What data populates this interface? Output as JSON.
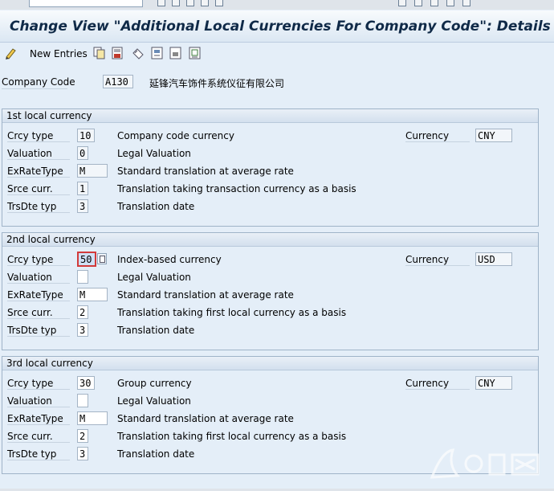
{
  "window": {
    "title": "Change View \"Additional Local Currencies For Company Code\": Details"
  },
  "toolbar": {
    "new_entries_label": "New Entries",
    "icons": [
      "glasses-edit-icon",
      "copy-icon",
      "save-icon",
      "undo-icon",
      "select-all-icon",
      "deselect-icon",
      "print-icon"
    ]
  },
  "company": {
    "label": "Company Code",
    "code": "A130",
    "name": "延锋汽车饰件系统仪征有限公司"
  },
  "groups": [
    {
      "title": "1st local currency",
      "crcy_type_label": "Crcy type",
      "crcy_type": "10",
      "crcy_type_desc": "Company code currency",
      "currency_label": "Currency",
      "currency": "CNY",
      "valuation_label": "Valuation",
      "valuation": "0",
      "valuation_desc": "Legal Valuation",
      "exratetype_label": "ExRateType",
      "exratetype": "M",
      "exratetype_desc": "Standard translation at average rate",
      "srce_label": "Srce curr.",
      "srce": "1",
      "srce_desc": "Translation taking transaction currency as a basis",
      "trsdte_label": "TrsDte typ",
      "trsdte": "3",
      "trsdte_desc": "Translation date"
    },
    {
      "title": "2nd local currency",
      "crcy_type_label": "Crcy type",
      "crcy_type": "50",
      "crcy_type_desc": "Index-based currency",
      "currency_label": "Currency",
      "currency": "USD",
      "valuation_label": "Valuation",
      "valuation": "",
      "valuation_desc": "Legal Valuation",
      "exratetype_label": "ExRateType",
      "exratetype": "M",
      "exratetype_desc": "Standard translation at average rate",
      "srce_label": "Srce curr.",
      "srce": "2",
      "srce_desc": "Translation taking first local currency as a basis",
      "trsdte_label": "TrsDte typ",
      "trsdte": "3",
      "trsdte_desc": "Translation date"
    },
    {
      "title": "3rd local currency",
      "crcy_type_label": "Crcy type",
      "crcy_type": "30",
      "crcy_type_desc": "Group currency",
      "currency_label": "Currency",
      "currency": "CNY",
      "valuation_label": "Valuation",
      "valuation": "",
      "valuation_desc": "Legal Valuation",
      "exratetype_label": "ExRateType",
      "exratetype": "M",
      "exratetype_desc": "Standard translation at average rate",
      "srce_label": "Srce curr.",
      "srce": "2",
      "srce_desc": "Translation taking first local currency as a basis",
      "trsdte_label": "TrsDte typ",
      "trsdte": "3",
      "trsdte_desc": "Translation date"
    }
  ],
  "colors": {
    "background": "#e4eef8",
    "title_text": "#102a48",
    "focus_border": "#d23a3a"
  }
}
